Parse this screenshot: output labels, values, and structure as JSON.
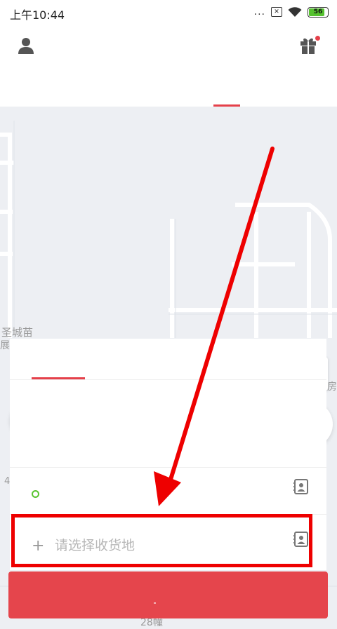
{
  "status_bar": {
    "time": "上午10:44",
    "signal_dots": "...",
    "battery_level": "56"
  },
  "map": {
    "labels": [
      "圣城苗",
      "展",
      "庄房",
      "28幢",
      "4"
    ]
  },
  "form": {
    "destination_placeholder": "请选择收货地",
    "add_symbol": "+"
  },
  "colors": {
    "accent": "#e5404a",
    "confirm_button": "#e5454c",
    "origin_dot": "#5ac431",
    "annotation": "#ee0000"
  },
  "icons": [
    "avatar-icon",
    "gift-icon",
    "locate-icon",
    "contacts-icon",
    "arrow-annotation"
  ]
}
